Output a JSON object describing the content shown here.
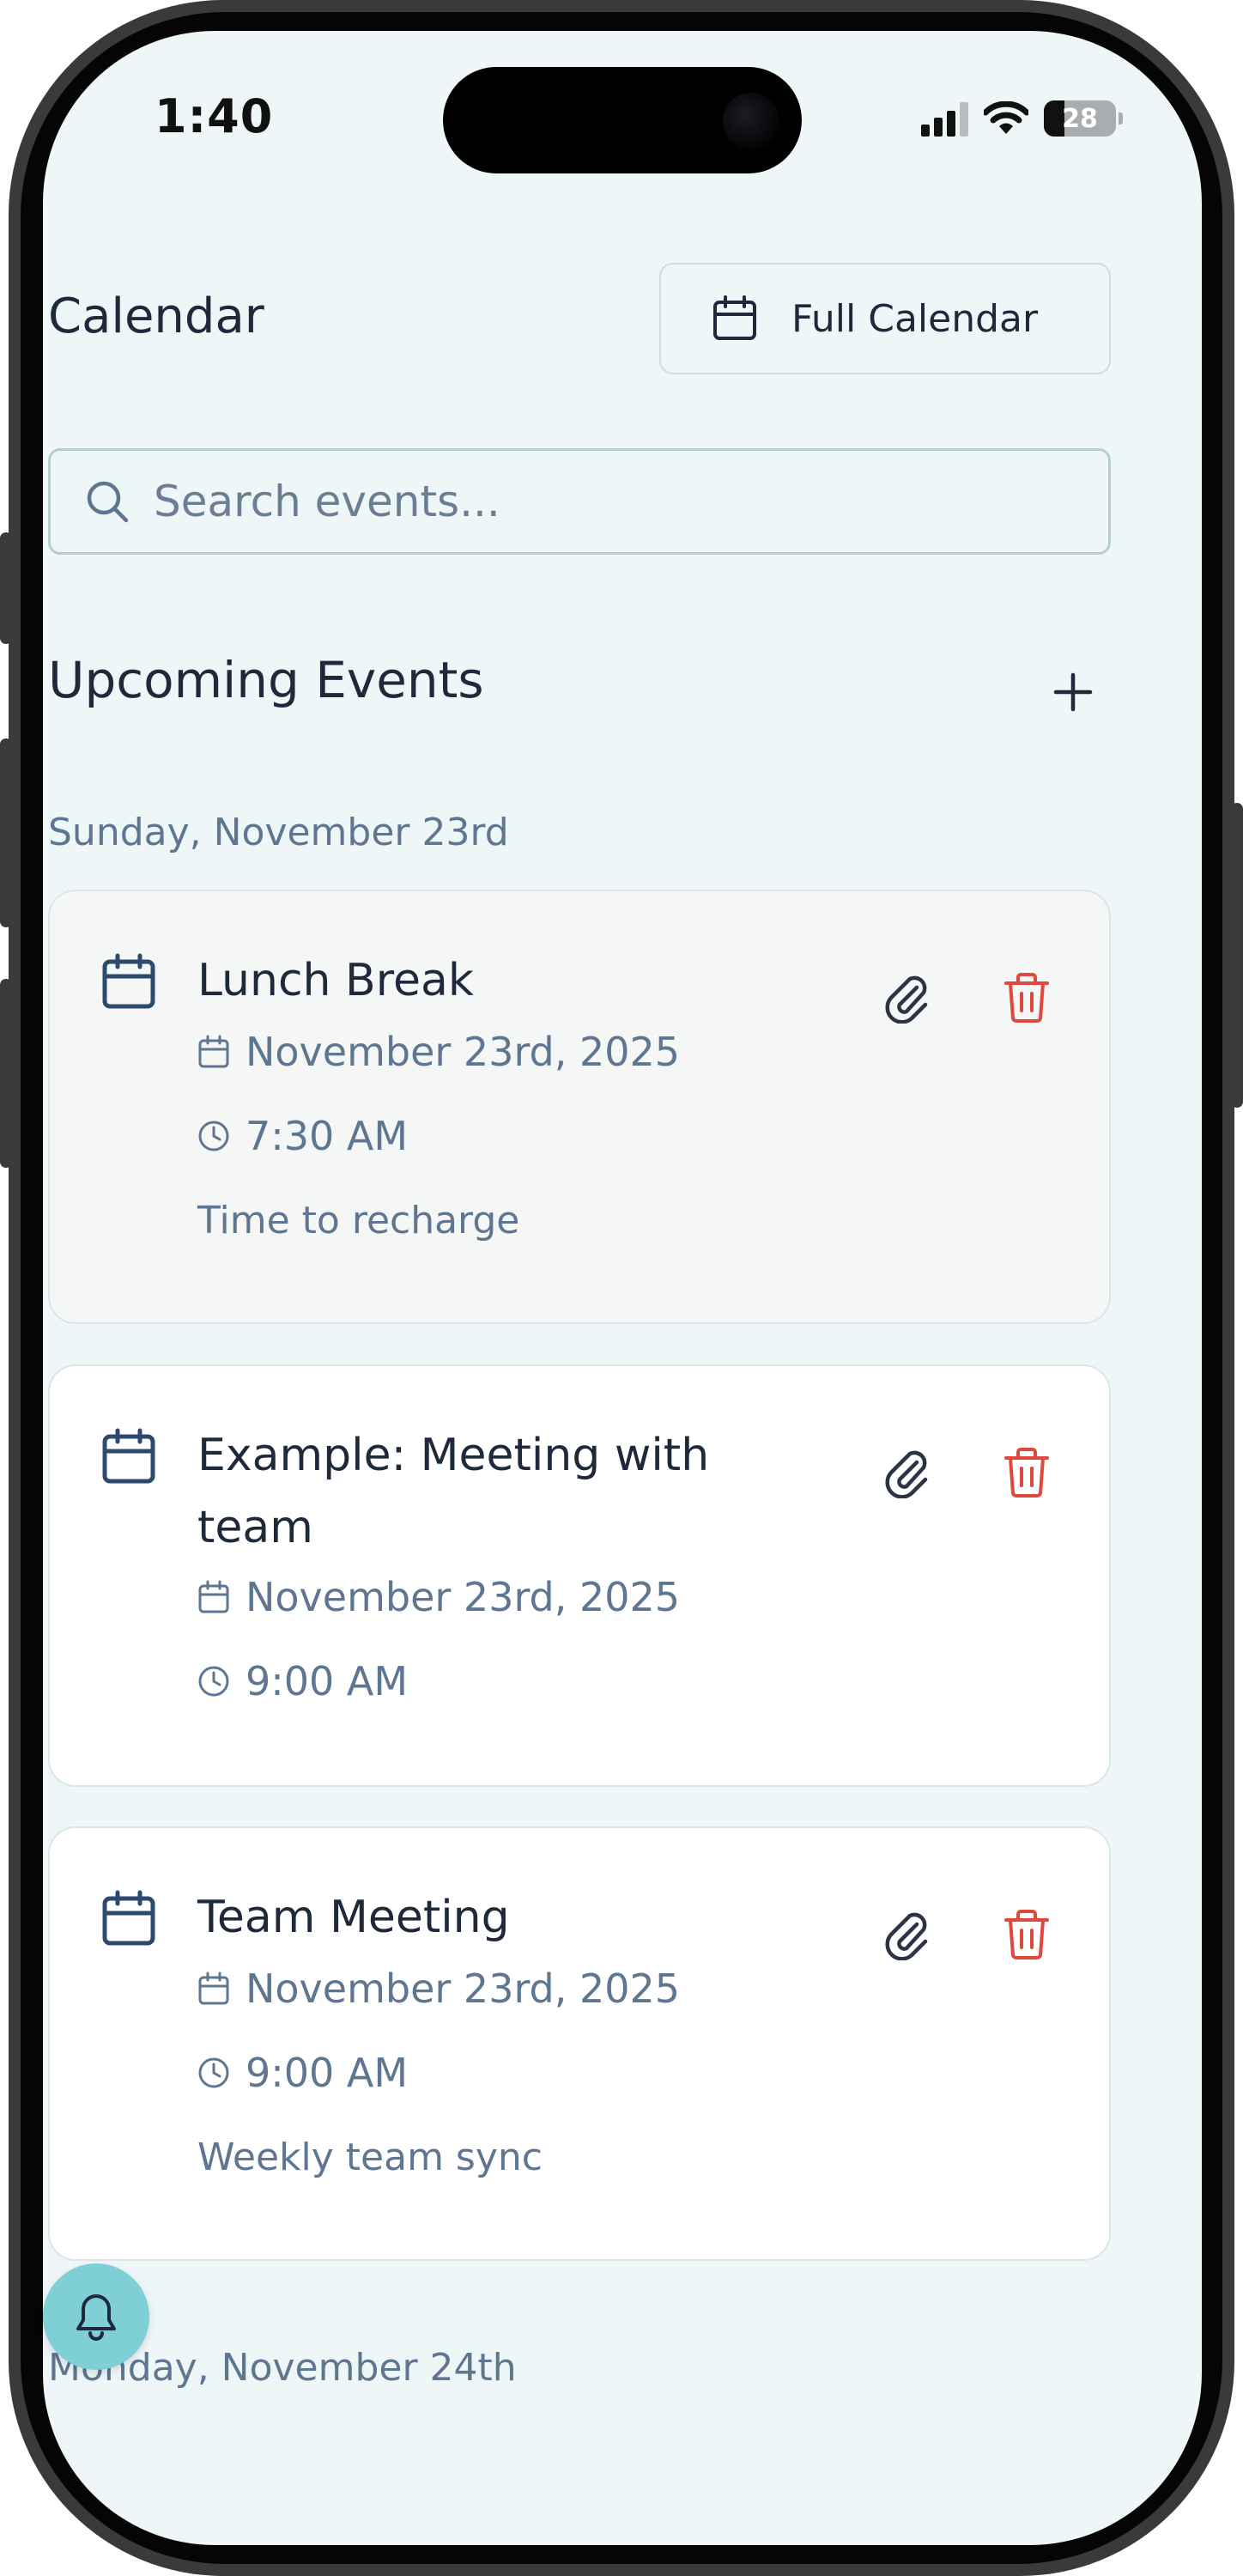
{
  "status_bar": {
    "time": "1:40",
    "battery_level": "28"
  },
  "header": {
    "title": "Calendar",
    "full_calendar_label": "Full Calendar"
  },
  "search": {
    "placeholder": "Search events...",
    "value": ""
  },
  "upcoming": {
    "title": "Upcoming Events"
  },
  "days": [
    {
      "label": "Sunday, November 23rd",
      "events": [
        {
          "title": "Lunch Break",
          "date": "November 23rd, 2025",
          "time": "7:30 AM",
          "description": "Time to recharge"
        },
        {
          "title": "Example: Meeting with team",
          "date": "November 23rd, 2025",
          "time": "9:00 AM",
          "description": ""
        },
        {
          "title": "Team Meeting",
          "date": "November 23rd, 2025",
          "time": "9:00 AM",
          "description": "Weekly team sync"
        }
      ]
    },
    {
      "label": "Monday, November 24th",
      "events": []
    }
  ],
  "colors": {
    "accent": "#7fcfd6",
    "text": "#1e2a3b",
    "muted": "#5e7690",
    "delete": "#e0483e",
    "background": "#eef6f8"
  }
}
